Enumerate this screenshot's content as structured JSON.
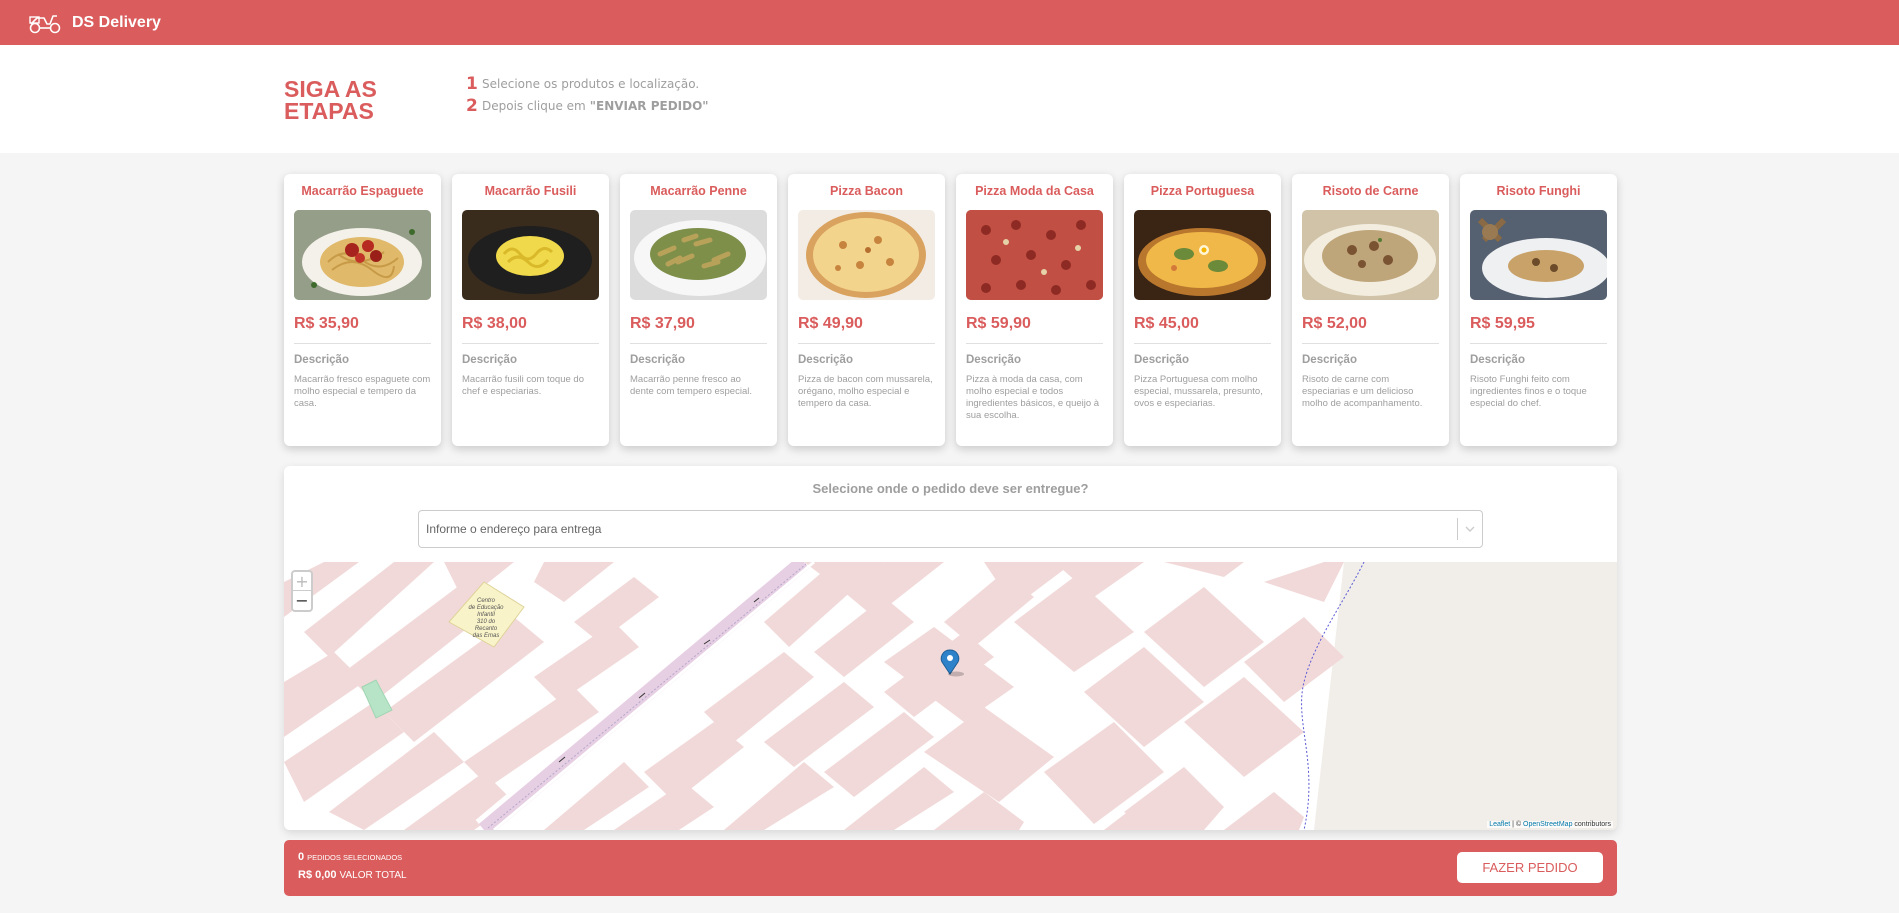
{
  "header": {
    "brand": "DS Delivery",
    "logo_icon": "delivery-scooter-icon"
  },
  "steps": {
    "title": "SIGA AS ETAPAS",
    "items": [
      {
        "number": "1",
        "text": "Selecione os produtos e localização.",
        "highlight": ""
      },
      {
        "number": "2",
        "text": "Depois clique em",
        "highlight": "\"ENVIAR PEDIDO\""
      }
    ]
  },
  "products": [
    {
      "name": "Macarrão Espaguete",
      "price": "R$ 35,90",
      "desc_title": "Descrição",
      "description": "Macarrão fresco espaguete com molho especial e tempero da casa."
    },
    {
      "name": "Macarrão Fusili",
      "price": "R$ 38,00",
      "desc_title": "Descrição",
      "description": "Macarrão fusili com toque do chef e especiarias."
    },
    {
      "name": "Macarrão Penne",
      "price": "R$ 37,90",
      "desc_title": "Descrição",
      "description": "Macarrão penne fresco ao dente com tempero especial."
    },
    {
      "name": "Pizza Bacon",
      "price": "R$ 49,90",
      "desc_title": "Descrição",
      "description": "Pizza de bacon com mussarela, orégano, molho especial e tempero da casa."
    },
    {
      "name": "Pizza Moda da Casa",
      "price": "R$ 59,90",
      "desc_title": "Descrição",
      "description": "Pizza à moda da casa, com molho especial e todos ingredientes básicos, e queijo à sua escolha."
    },
    {
      "name": "Pizza Portuguesa",
      "price": "R$ 45,00",
      "desc_title": "Descrição",
      "description": "Pizza Portuguesa com molho especial, mussarela, presunto, ovos e especiarias."
    },
    {
      "name": "Risoto de Carne",
      "price": "R$ 52,00",
      "desc_title": "Descrição",
      "description": "Risoto de carne com especiarias e um delicioso molho de acompanhamento."
    },
    {
      "name": "Risoto Funghi",
      "price": "R$ 59,95",
      "desc_title": "Descrição",
      "description": "Risoto Funghi feito com ingredientes finos e o toque especial do chef."
    }
  ],
  "location": {
    "title": "Selecione onde o pedido deve ser entregue?",
    "placeholder": "Informe o endereço para entrega",
    "map_label": "Centro de Educação Infantil 310 do Recanto das Emas",
    "zoom_in": "+",
    "zoom_out": "−",
    "attribution_leaflet": "Leaflet",
    "attribution_sep": " | © ",
    "attribution_osm": "OpenStreetMap",
    "attribution_suffix": " contributors"
  },
  "summary": {
    "count": "0",
    "count_label": "PEDIDOS SELECIONADOS",
    "total": "R$ 0,00",
    "total_label": "VALOR TOTAL",
    "button": "FAZER PEDIDO"
  },
  "colors": {
    "primary": "#da5c5c",
    "text_muted": "#9e9e9e",
    "background": "#f5f5f5"
  }
}
